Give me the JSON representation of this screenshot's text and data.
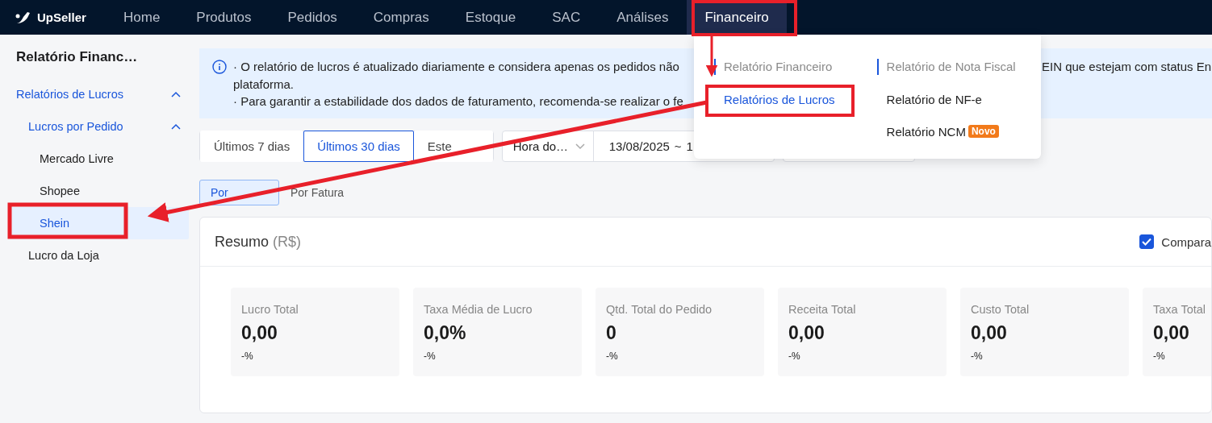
{
  "app": {
    "logo": "UpSeller"
  },
  "nav": [
    {
      "label": "Home",
      "selected": false
    },
    {
      "label": "Produtos",
      "selected": false
    },
    {
      "label": "Pedidos",
      "selected": false
    },
    {
      "label": "Compras",
      "selected": false
    },
    {
      "label": "Estoque",
      "selected": false
    },
    {
      "label": "SAC",
      "selected": false
    },
    {
      "label": "Análises",
      "selected": false
    },
    {
      "label": "Financeiro",
      "selected": true
    }
  ],
  "nav_menu": {
    "columns": [
      {
        "heading": "Relatório Financeiro",
        "items": [
          {
            "label": "Relatórios de Lucros",
            "selected": true
          }
        ]
      },
      {
        "heading": "Relatório de Nota Fiscal",
        "items": [
          {
            "label": "Relatório de NF-e",
            "selected": false
          },
          {
            "label": "Relatório NCM",
            "selected": false,
            "badge": "Novo"
          }
        ]
      }
    ]
  },
  "sidebar": {
    "title": "Relatório Financ…",
    "items": [
      {
        "label": "Relatórios de Lucros",
        "selected": false,
        "expanded": true,
        "children": [
          {
            "label": "Lucros por Pedido",
            "selected": false,
            "expanded": true,
            "children": [
              {
                "label": "Mercado Livre",
                "selected": false
              },
              {
                "label": "Shopee",
                "selected": false
              },
              {
                "label": "Shein",
                "selected": true
              }
            ]
          },
          {
            "label": "Lucro da Loja",
            "selected": false
          }
        ]
      }
    ]
  },
  "notice": {
    "line1_start": "· O relatório de lucros é atualizado diariamente e considera apenas os pedidos não",
    "line1_end": "EIN que estejam com status En",
    "line2": "plataforma.",
    "line3": "· Para garantir a estabilidade dos dados de faturamento, recomenda-se realizar o fe"
  },
  "filters": {
    "ranges": [
      {
        "label": "Últimos 7 dias",
        "selected": false
      },
      {
        "label": "Últimos 30 dias",
        "selected": true
      },
      {
        "label": "Este",
        "selected": false
      }
    ],
    "time_select": "Hora do…",
    "date_start": "13/08/2025",
    "date_separator": "~",
    "date_end": "1"
  },
  "view_tabs": [
    {
      "label": "Por",
      "selected": true
    },
    {
      "label": "Por Fatura",
      "selected": false
    }
  ],
  "summary": {
    "title": "Resumo",
    "currency": "(R$)",
    "compare": {
      "label": "Compara",
      "checked": true
    },
    "metrics": [
      {
        "label": "Lucro Total",
        "value": "0,00",
        "change": "-%"
      },
      {
        "label": "Taxa Média de Lucro",
        "value": "0,0%",
        "change": "-%"
      },
      {
        "label": "Qtd. Total do Pedido",
        "value": "0",
        "change": "-%"
      },
      {
        "label": "Receita Total",
        "value": "0,00",
        "change": "-%"
      },
      {
        "label": "Custo Total",
        "value": "0,00",
        "change": "-%"
      },
      {
        "label": "Taxa Total",
        "value": "0,00",
        "change": "-%"
      }
    ]
  }
}
